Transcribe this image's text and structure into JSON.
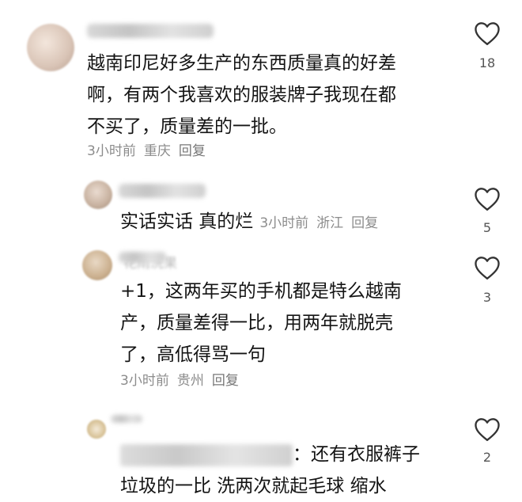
{
  "comments": [
    {
      "lines": [
        "越南印尼好多生产的东西质量真的好差",
        "啊，有两个我喜欢的服装牌子我现在都",
        "不买了，质量差的一批。"
      ],
      "time": "3小时前",
      "location": "重庆",
      "reply_label": "回复",
      "likes": "18"
    },
    {
      "text": "实话实话 真的烂",
      "time": "3小时前",
      "location": "浙江",
      "reply_label": "回复",
      "likes": "5"
    },
    {
      "name_partial": "花雨洗果",
      "lines": [
        "+1，这两年买的手机都是特么越南",
        "产，质量差得一比，用两年就脱壳",
        "了，高低得骂一句"
      ],
      "time": "3小时前",
      "location": "贵州",
      "reply_label": "回复",
      "likes": "3"
    },
    {
      "line1_suffix": "：还有衣服裤子",
      "line2": "垃圾的一比 洗两次就起毛球 缩水",
      "likes": "2"
    }
  ],
  "icons": {
    "like": "heart-outline-icon"
  }
}
